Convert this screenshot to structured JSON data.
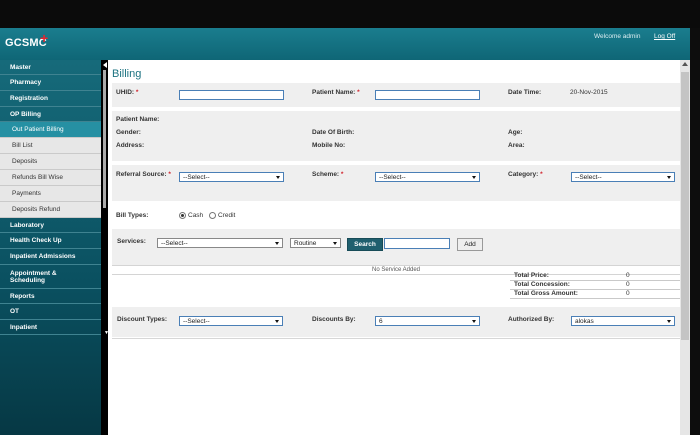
{
  "app": {
    "logo": "GCSMC",
    "welcome": "Welcome admin",
    "logoff": "Log Off"
  },
  "nav": {
    "master": "Master",
    "pharmacy": "Pharmacy",
    "registration": "Registration",
    "op_billing": "OP Billing",
    "op_sub": [
      "Out Patient Billing",
      "Bill List",
      "Deposits",
      "Refunds Bill Wise",
      "Payments",
      "Deposits Refund"
    ],
    "laboratory": "Laboratory",
    "health_check": "Health Check Up",
    "inpatient_admissions": "Inpatient Admissions",
    "appointment_line1": "Appointment &",
    "appointment_line2": "Scheduling",
    "reports": "Reports",
    "ot": "OT",
    "inpatient": "Inpatient"
  },
  "page": {
    "title": "Billing"
  },
  "form": {
    "uhid_label": "UHID:",
    "patient_name_label": "Patient Name:",
    "date_time_label": "Date Time:",
    "date_time_value": "20-Nov-2015",
    "required_mark": "*",
    "info": {
      "patient_name": "Patient Name:",
      "gender": "Gender:",
      "dob": "Date Of Birth:",
      "age": "Age:",
      "address": "Address:",
      "mobile": "Mobile No:",
      "area": "Area:"
    },
    "referral_label": "Referral Source:",
    "referral_value": "--Select--",
    "scheme_label": "Scheme:",
    "scheme_value": "--Select--",
    "category_label": "Category:",
    "category_value": "--Select--",
    "bill_types_label": "Bill Types:",
    "bill_type_cash": "Cash",
    "bill_type_credit": "Credit"
  },
  "services": {
    "label": "Services:",
    "select_value": "--Select--",
    "priority_value": "Routine",
    "search_button": "Search",
    "add_button": "Add",
    "empty_text": "No Service Added"
  },
  "totals": [
    {
      "label": "Total Price:",
      "value": "0"
    },
    {
      "label": "Total Concession:",
      "value": "0"
    },
    {
      "label": "Total Gross Amount:",
      "value": "0"
    }
  ],
  "discount": {
    "types_label": "Discount Types:",
    "types_value": "--Select--",
    "by_label": "Discounts By:",
    "by_value": "6",
    "authorized_label": "Authorized By:",
    "authorized_value": "alokas"
  }
}
